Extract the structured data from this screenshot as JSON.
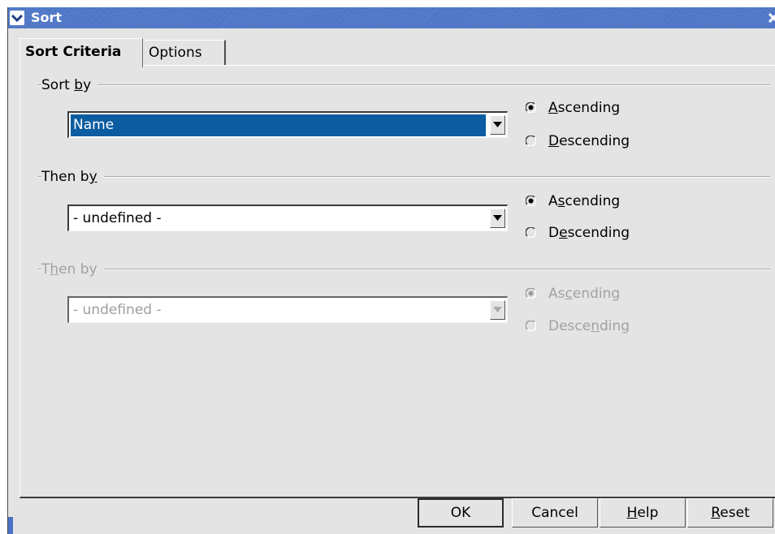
{
  "window": {
    "title": "Sort"
  },
  "tabs": [
    {
      "label": "Sort Criteria",
      "active": true
    },
    {
      "label": "Options",
      "active": false
    }
  ],
  "groups": [
    {
      "legend_pre": "Sort ",
      "legend_key": "b",
      "legend_post": "y",
      "field_value": "Name",
      "selected": true,
      "enabled": true,
      "ascending": {
        "pre": "",
        "key": "A",
        "post": "scending",
        "checked": true
      },
      "descending": {
        "pre": "",
        "key": "D",
        "post": "escending",
        "checked": false
      }
    },
    {
      "legend_pre": "Then b",
      "legend_key": "y",
      "legend_post": "",
      "field_value": "- undefined -",
      "selected": false,
      "enabled": true,
      "ascending": {
        "pre": "A",
        "key": "s",
        "post": "cending",
        "checked": true
      },
      "descending": {
        "pre": "D",
        "key": "e",
        "post": "scending",
        "checked": false
      }
    },
    {
      "legend_pre": "T",
      "legend_key": "h",
      "legend_post": "en by",
      "field_value": "- undefined -",
      "selected": false,
      "enabled": false,
      "ascending": {
        "pre": "As",
        "key": "c",
        "post": "ending",
        "checked": true
      },
      "descending": {
        "pre": "Desce",
        "key": "n",
        "post": "ding",
        "checked": false
      }
    }
  ],
  "buttons": {
    "ok": {
      "label": "OK"
    },
    "cancel": {
      "label": "Cancel"
    },
    "help": {
      "pre": "",
      "key": "H",
      "post": "elp"
    },
    "reset": {
      "pre": "",
      "key": "R",
      "post": "eset"
    }
  },
  "icons": {
    "window_menu": "chevron-down-icon",
    "close": "close-icon",
    "dropdown": "triangle-down-icon",
    "radio_on": "radio-selected-icon",
    "radio_off": "radio-unselected-icon"
  },
  "colors": {
    "titlebar": "#4a73c4",
    "selection": "#0b5ca0",
    "dialog_bg": "#e4e4e4",
    "disabled_text": "#a2a2a2"
  }
}
